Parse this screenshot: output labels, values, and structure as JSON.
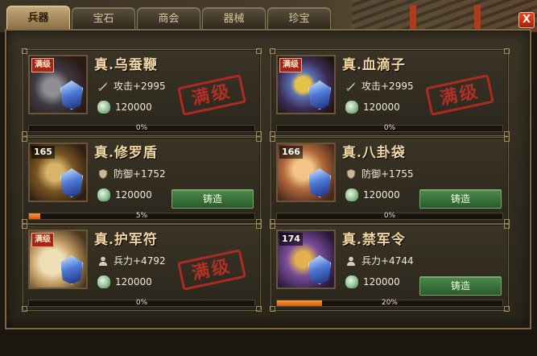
{
  "tabs": [
    {
      "label": "兵器",
      "active": true
    },
    {
      "label": "宝石",
      "active": false
    },
    {
      "label": "商会",
      "active": false
    },
    {
      "label": "器械",
      "active": false
    },
    {
      "label": "珍宝",
      "active": false
    }
  ],
  "close_label": "X",
  "max_stamp": "满级",
  "forge_label": "铸造",
  "items": [
    {
      "name": "真.乌蚕鞭",
      "level": "满级",
      "max": true,
      "stat_icon": "sword-icon",
      "stat": "攻击+2995",
      "cost": "120000",
      "progress": 0,
      "progress_text": "0%"
    },
    {
      "name": "真.血滴子",
      "level": "满级",
      "max": true,
      "stat_icon": "sword-icon",
      "stat": "攻击+2995",
      "cost": "120000",
      "progress": 0,
      "progress_text": "0%"
    },
    {
      "name": "真.修罗盾",
      "level": "165",
      "max": false,
      "stat_icon": "shield-icon",
      "stat": "防御+1752",
      "cost": "120000",
      "progress": 5,
      "progress_text": "5%"
    },
    {
      "name": "真.八卦袋",
      "level": "166",
      "max": false,
      "stat_icon": "shield-icon",
      "stat": "防御+1755",
      "cost": "120000",
      "progress": 0,
      "progress_text": "0%"
    },
    {
      "name": "真.护军符",
      "level": "满级",
      "max": true,
      "stat_icon": "soldier-icon",
      "stat": "兵力+4792",
      "cost": "120000",
      "progress": 0,
      "progress_text": "0%"
    },
    {
      "name": "真.禁军令",
      "level": "174",
      "max": false,
      "stat_icon": "soldier-icon",
      "stat": "兵力+4744",
      "cost": "120000",
      "progress": 20,
      "progress_text": "20%"
    }
  ],
  "colors": {
    "stamp": "#c22a22",
    "forge_button": "#3f7a3e",
    "progress_fill": "#e87a22",
    "name_text": "#f3d7a3"
  }
}
